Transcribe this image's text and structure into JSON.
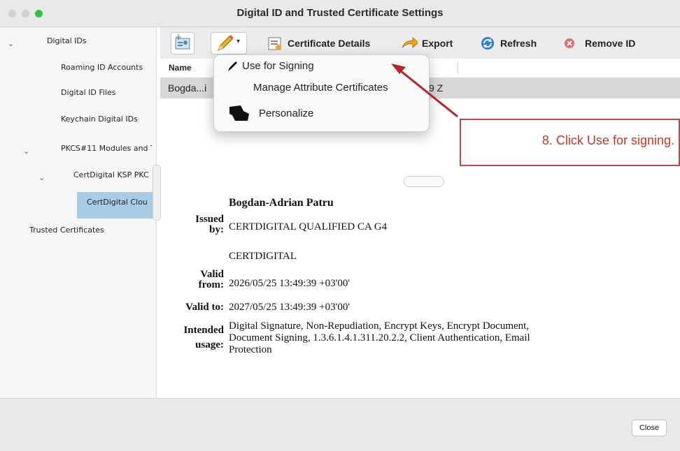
{
  "window": {
    "title": "Digital ID and Trusted Certificate Settings"
  },
  "sidebar": {
    "items": [
      {
        "label": "Digital IDs"
      },
      {
        "label": "Roaming ID Accounts"
      },
      {
        "label": "Digital ID Files"
      },
      {
        "label": "Keychain Digital IDs"
      },
      {
        "label": "PKCS#11 Modules and T"
      },
      {
        "label": "CertDigital KSP PKC"
      },
      {
        "label": "CertDigital Clou"
      },
      {
        "label": "Trusted Certificates"
      }
    ]
  },
  "toolbar": {
    "certificate_details": "Certificate Details",
    "export": "Export",
    "refresh": "Refresh",
    "remove_id": "Remove ID"
  },
  "list": {
    "column_name": "Name",
    "row_text": "Bogda...i",
    "row_tail": "9 Z"
  },
  "menu": {
    "use_for_signing": "Use for Signing",
    "manage_attribute_certificates": "Manage Attribute Certificates",
    "personalize": "Personalize"
  },
  "callout": {
    "text": "8. Click Use for signing."
  },
  "details": {
    "name": "Bogdan-Adrian Patru",
    "issued_by_label_1": "Issued",
    "issued_by_label_2": "by:",
    "issued_by_value": "CERTDIGITAL QUALIFIED CA G4",
    "issued_by_org": "CERTDIGITAL",
    "valid_from_label_1": "Valid",
    "valid_from_label_2": "from:",
    "valid_from_value": "2026/05/25 13:49:39 +03'00'",
    "valid_to_label": "Valid to:",
    "valid_to_value": "2027/05/25 13:49:39 +03'00'",
    "usage_label_1": "Intended",
    "usage_label_2": "usage:",
    "usage_line_1": "Digital Signature, Non-Repudiation, Encrypt Keys, Encrypt Document,",
    "usage_line_2": "Document Signing, 1.3.6.1.4.1.311.20.2.2, Client Authentication, Email",
    "usage_line_3": "Protection"
  },
  "footer": {
    "close_label": "Close"
  },
  "colors": {
    "accent_selection": "#a8cbe8",
    "callout_border": "#b54a4a",
    "callout_text": "#c0392b",
    "arrow": "#b3262a"
  }
}
